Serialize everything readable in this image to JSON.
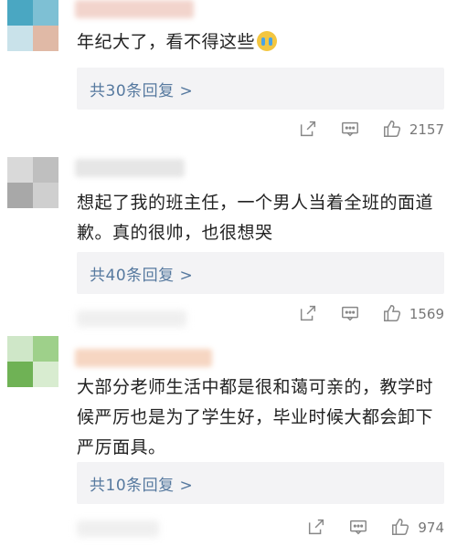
{
  "comments": [
    {
      "text": "年纪大了，看不得这些",
      "reply_label": "共30条回复 >",
      "likes": "2157",
      "icons": [
        "share-icon",
        "comment-icon",
        "like-icon"
      ]
    },
    {
      "text": "想起了我的班主任，一个男人当着全班的面道歉。真的很帅，也很想哭",
      "reply_label": "共40条回复 >",
      "likes": "1569",
      "icons": [
        "share-icon",
        "comment-icon",
        "like-icon"
      ]
    },
    {
      "text": "大部分老师生活中都是很和蔼可亲的，教学时候严厉也是为了学生好，毕业时候大都会卸下严厉面具。",
      "reply_label": "共10条回复 >",
      "likes": "974",
      "icons": [
        "share-icon",
        "comment-icon",
        "like-icon"
      ]
    }
  ],
  "colors": {
    "reply_link": "#56799f",
    "reply_bg": "#f3f3f5",
    "text": "#222222",
    "meta": "#777777"
  }
}
